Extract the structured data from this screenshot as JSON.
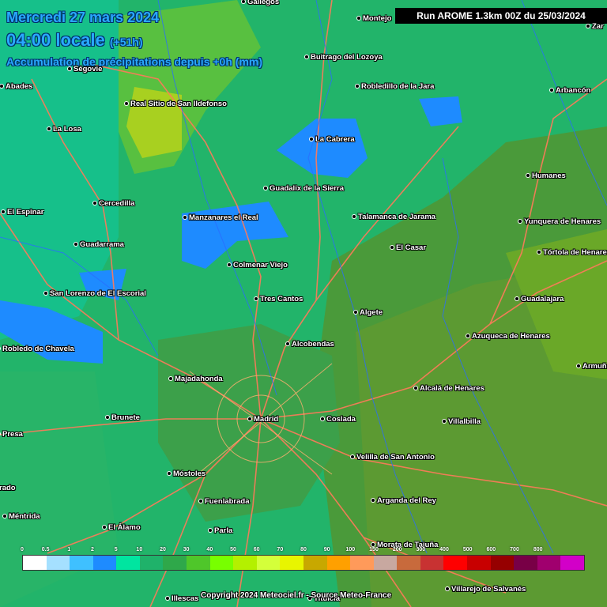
{
  "header": {
    "date": "Mercredi 27 mars 2024",
    "time": "04:00 locale",
    "offset": "(+51h)",
    "parameter": "Accumulation de précipitations depuis +0h (mm)"
  },
  "run_info": "Run AROME 1.3km 00Z du 25/03/2024",
  "cities": [
    {
      "name": "Gallegos"
    },
    {
      "name": "Montejo"
    },
    {
      "name": "Buitrago del Lozoya"
    },
    {
      "name": "Ségovie"
    },
    {
      "name": "Abades"
    },
    {
      "name": "Robledillo de la Jara"
    },
    {
      "name": "Arbancón"
    },
    {
      "name": "Real Sitio de San Ildefonso"
    },
    {
      "name": "La Losa"
    },
    {
      "name": "La Cabrera"
    },
    {
      "name": "Humanes"
    },
    {
      "name": "Guadalix de la Sierra"
    },
    {
      "name": "Cercedilla"
    },
    {
      "name": "El Espinar"
    },
    {
      "name": "Manzanares el Real"
    },
    {
      "name": "Talamanca de Jarama"
    },
    {
      "name": "Yunquera de Henares"
    },
    {
      "name": "Guadarrama"
    },
    {
      "name": "El Casar"
    },
    {
      "name": "Tórtola de Henares"
    },
    {
      "name": "Colmenar Viejo"
    },
    {
      "name": "San Lorenzo de El Escorial"
    },
    {
      "name": "Tres Cantos"
    },
    {
      "name": "Guadalajara"
    },
    {
      "name": "Algete"
    },
    {
      "name": "Robledo de Chavela"
    },
    {
      "name": "Alcobendas"
    },
    {
      "name": "Azuqueca de Henares"
    },
    {
      "name": "Majadahonda"
    },
    {
      "name": "Armuña"
    },
    {
      "name": "Alcalá de Henares"
    },
    {
      "name": "Brunete"
    },
    {
      "name": "Madrid"
    },
    {
      "name": "Coslada"
    },
    {
      "name": "Villalbilla"
    },
    {
      "name": "Presa"
    },
    {
      "name": "Velilla de San Antonio"
    },
    {
      "name": "Móstoles"
    },
    {
      "name": "rado"
    },
    {
      "name": "Fuenlabrada"
    },
    {
      "name": "Arganda del Rey"
    },
    {
      "name": "Méntrida"
    },
    {
      "name": "El Álamo"
    },
    {
      "name": "Parla"
    },
    {
      "name": "Morata de Tajuña"
    },
    {
      "name": "Villarejo de Salvanés"
    },
    {
      "name": "Illescas"
    },
    {
      "name": "Titulcia"
    },
    {
      "name": "Zar"
    }
  ],
  "legend": {
    "ticks": [
      "0",
      "0.5",
      "1",
      "2",
      "5",
      "10",
      "20",
      "30",
      "40",
      "50",
      "60",
      "70",
      "80",
      "90",
      "100",
      "150",
      "200",
      "300",
      "400",
      "500",
      "600",
      "700",
      "800"
    ],
    "colors": [
      "#ffffff",
      "#a5e0ff",
      "#3fc0ff",
      "#1e8bff",
      "#00e5a0",
      "#1fb26a",
      "#2fa84a",
      "#4fc62a",
      "#78ff00",
      "#b4f000",
      "#d4ff3a",
      "#e8f500",
      "#c8a800",
      "#ffa000",
      "#ff9a5a",
      "#c8a8a0",
      "#c86a3c",
      "#c83232",
      "#ff0000",
      "#c80000",
      "#960000",
      "#780046",
      "#a0006e",
      "#d200c8"
    ]
  },
  "copyright": "Copyright 2024 Meteociel.fr - Source Meteo-France"
}
